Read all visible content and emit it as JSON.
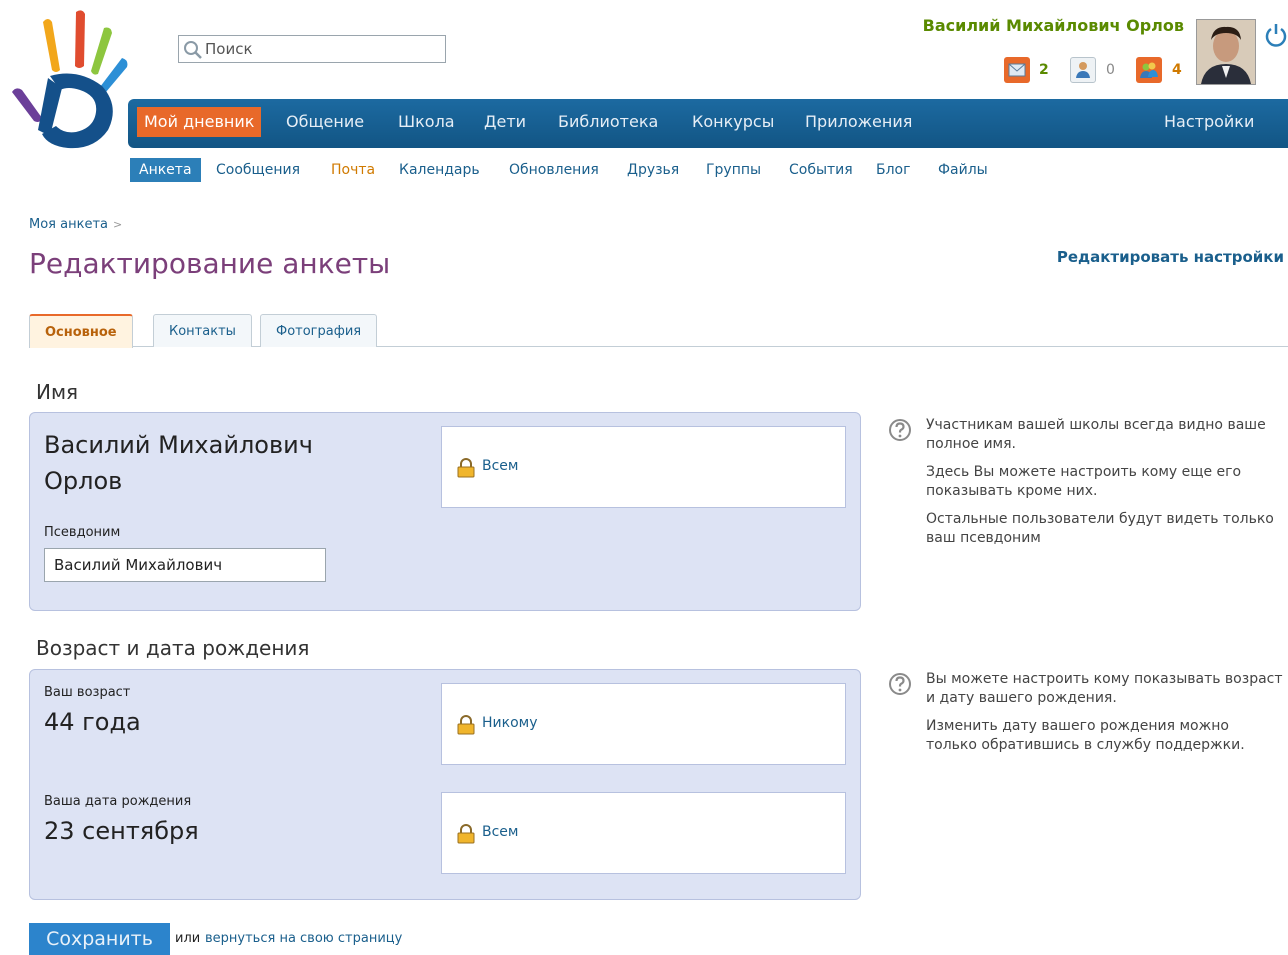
{
  "search": {
    "placeholder": "Поиск"
  },
  "user": {
    "name": "Василий Михайлович Орлов",
    "counters": {
      "messages": "2",
      "friend_requests": "0",
      "groups": "4"
    }
  },
  "main_nav": {
    "items": [
      "Мой дневник",
      "Общение",
      "Школа",
      "Дети",
      "Библиотека",
      "Конкурсы",
      "Приложения"
    ],
    "settings": "Настройки"
  },
  "sub_nav": {
    "items": [
      "Анкета",
      "Сообщения",
      "Почта",
      "Календарь",
      "Обновления",
      "Друзья",
      "Группы",
      "События",
      "Блог",
      "Файлы"
    ]
  },
  "breadcrumb": {
    "label": "Моя анкета",
    "sep": ">"
  },
  "page": {
    "title": "Редактирование анкеты",
    "edit_settings": "Редактировать настройки"
  },
  "tabs": [
    "Основное",
    "Контакты",
    "Фотография"
  ],
  "name_section": {
    "heading": "Имя",
    "full_name_line1": "Василий Михайлович",
    "full_name_line2": "Орлов",
    "visibility": "Всем",
    "nickname_label": "Псевдоним",
    "nickname_value": "Василий Михайлович",
    "help": [
      "Участникам вашей школы всегда видно ваше полное имя.",
      "Здесь Вы можете настроить кому еще его показывать кроме них.",
      "Остальные пользователи будут видеть только ваш псевдоним"
    ]
  },
  "age_section": {
    "heading": "Возраст и дата рождения",
    "age_label": "Ваш возраст",
    "age_value": "44 года",
    "age_visibility": "Никому",
    "birthday_label": "Ваша дата рождения",
    "birthday_value": "23 сентября",
    "birthday_visibility": "Всем",
    "help": [
      "Вы можете настроить кому показывать возраст и дату вашего рождения.",
      "Изменить дату вашего рождения можно только обратившись в службу поддержки."
    ]
  },
  "actions": {
    "save": "Сохранить",
    "or": "или",
    "back": "вернуться на свою страницу"
  },
  "colors": {
    "nav_blue": "#1c6aa1",
    "accent_orange": "#e8692a",
    "title_purple": "#7b3f7a",
    "user_green": "#5a8a00",
    "panel_bg": "#dde3f4"
  }
}
